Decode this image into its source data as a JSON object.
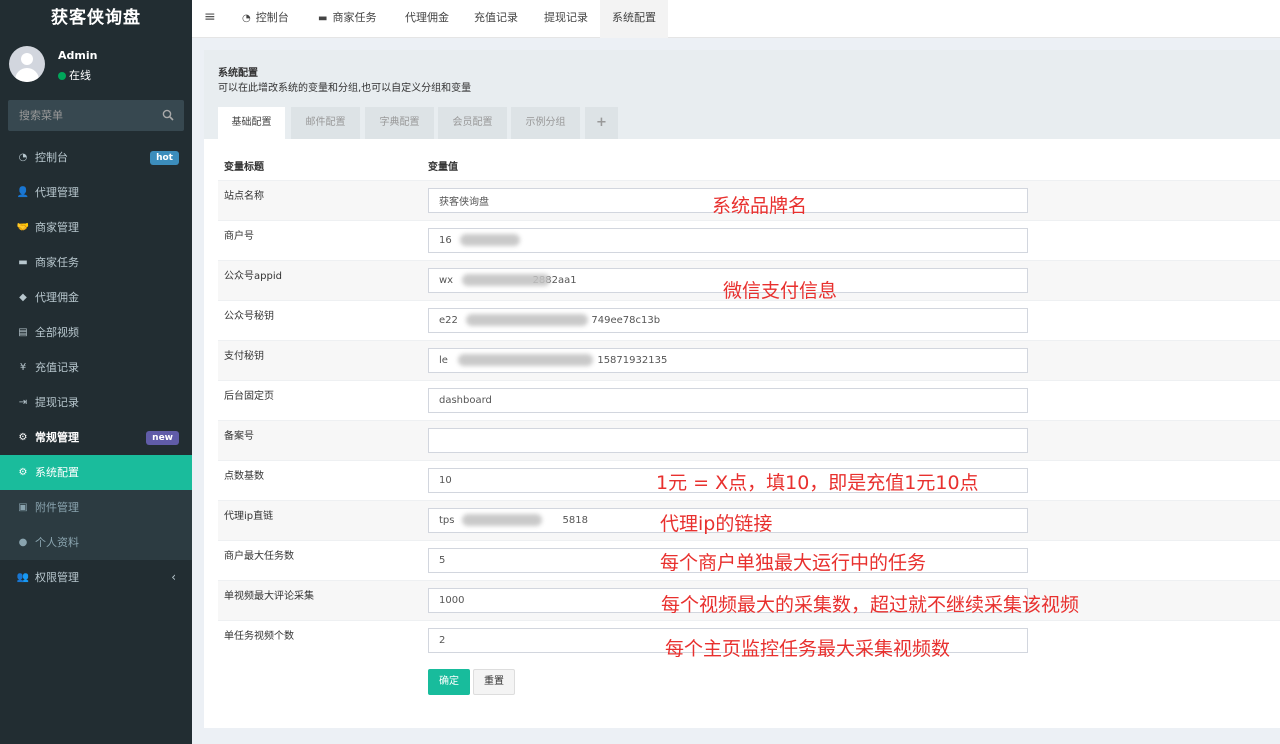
{
  "app": {
    "brand": "获客侠询盘"
  },
  "user": {
    "name": "Admin",
    "status": "在线"
  },
  "search": {
    "placeholder": "搜索菜单"
  },
  "sidebar": {
    "items": [
      {
        "label": "控制台",
        "icon": "dashboard-icon",
        "badge": "hot"
      },
      {
        "label": "代理管理",
        "icon": "user-add-icon"
      },
      {
        "label": "商家管理",
        "icon": "handshake-icon"
      },
      {
        "label": "商家任务",
        "icon": "card-icon"
      },
      {
        "label": "代理佣金",
        "icon": "diamond-icon"
      },
      {
        "label": "全部视频",
        "icon": "file-icon"
      },
      {
        "label": "充值记录",
        "icon": "yen-icon"
      },
      {
        "label": "提现记录",
        "icon": "sign-in-icon"
      },
      {
        "label": "常规管理",
        "icon": "cogs-icon",
        "badge": "new"
      },
      {
        "label": "系统配置",
        "icon": "cog-icon"
      },
      {
        "label": "附件管理",
        "icon": "image-icon"
      },
      {
        "label": "个人资料",
        "icon": "user-icon"
      },
      {
        "label": "权限管理",
        "icon": "group-icon"
      }
    ]
  },
  "topnav": {
    "tabs": [
      {
        "label": "控制台",
        "icon": "dashboard-icon"
      },
      {
        "label": "商家任务",
        "icon": "card-icon"
      },
      {
        "label": "代理佣金"
      },
      {
        "label": "充值记录"
      },
      {
        "label": "提现记录"
      },
      {
        "label": "系统配置"
      }
    ]
  },
  "panel": {
    "title": "系统配置",
    "description": "可以在此增改系统的变量和分组,也可以自定义分组和变量",
    "tabs": [
      "基础配置",
      "邮件配置",
      "字典配置",
      "会员配置",
      "示例分组",
      "+"
    ]
  },
  "table": {
    "headers": [
      "变量标题",
      "变量值"
    ],
    "rows": [
      {
        "label": "站点名称",
        "value": "获客侠询盘"
      },
      {
        "label": "商户号",
        "value": "16"
      },
      {
        "label": "公众号appid",
        "value": "wx                         2882aa1"
      },
      {
        "label": "公众号秘钥",
        "value": "e22                                          749ee78c13b"
      },
      {
        "label": "支付秘钥",
        "value": "le                                               15871932135"
      },
      {
        "label": "后台固定页",
        "value": "dashboard"
      },
      {
        "label": "备案号",
        "value": ""
      },
      {
        "label": "点数基数",
        "value": "10"
      },
      {
        "label": "代理ip直链",
        "value": "tps                                  5818"
      },
      {
        "label": "商户最大任务数",
        "value": "5"
      },
      {
        "label": "单视频最大评论采集",
        "value": "1000"
      },
      {
        "label": "单任务视频个数",
        "value": "2"
      }
    ]
  },
  "annotations": [
    "系统品牌名",
    "微信支付信息",
    "1元 = X点，填10，即是充值1元10点",
    "代理ip的链接",
    "每个商户单独最大运行中的任务",
    "每个视频最大的采集数，超过就不继续采集该视频",
    "每个主页监控任务最大采集视频数"
  ],
  "buttons": {
    "ok": "确定",
    "reset": "重置"
  },
  "colors": {
    "sidebar_bg": "#222d32",
    "active_green": "#1abc9c",
    "annotation_red": "#e8302e",
    "hot_badge": "#3c8dbc",
    "new_badge": "#605ca8"
  }
}
